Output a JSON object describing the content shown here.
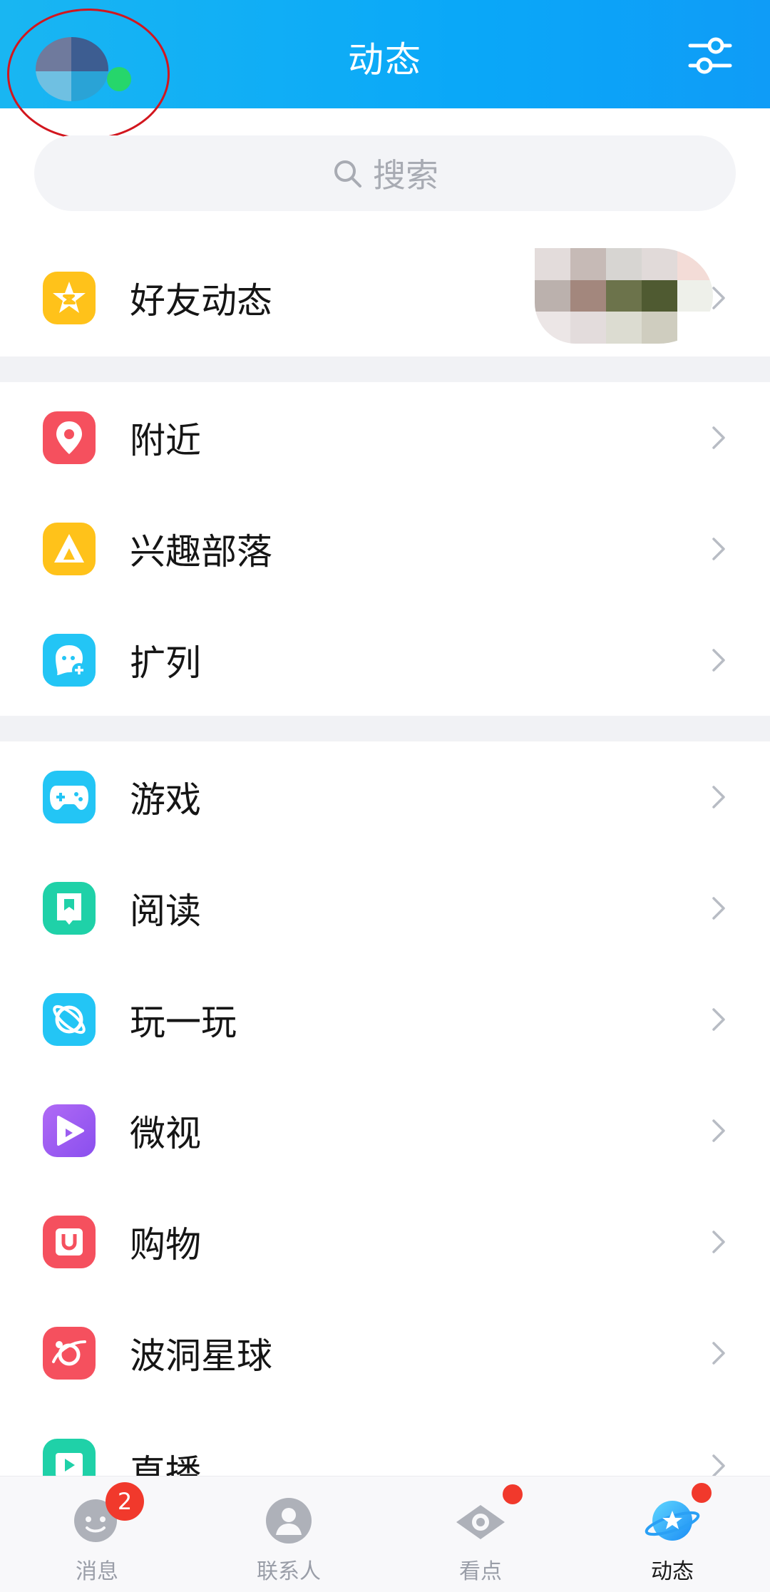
{
  "header": {
    "title": "动态"
  },
  "search": {
    "placeholder": "搜索"
  },
  "sections": [
    {
      "items": [
        {
          "label": "好友动态",
          "icon": "qzone-star-icon"
        }
      ]
    },
    {
      "items": [
        {
          "label": "附近",
          "icon": "location-pin-icon"
        },
        {
          "label": "兴趣部落",
          "icon": "tent-icon"
        },
        {
          "label": "扩列",
          "icon": "add-friend-face-icon"
        }
      ]
    },
    {
      "items": [
        {
          "label": "游戏",
          "icon": "gamepad-icon"
        },
        {
          "label": "阅读",
          "icon": "book-icon"
        },
        {
          "label": "玩一玩",
          "icon": "planet-icon"
        },
        {
          "label": "微视",
          "icon": "video-play-icon"
        },
        {
          "label": "购物",
          "icon": "shopping-bag-icon"
        },
        {
          "label": "波洞星球",
          "icon": "comic-planet-icon"
        },
        {
          "label": "直播",
          "icon": "live-icon"
        }
      ]
    }
  ],
  "tabs": [
    {
      "label": "消息",
      "icon": "message-face-icon",
      "badge": "2"
    },
    {
      "label": "联系人",
      "icon": "contacts-icon"
    },
    {
      "label": "看点",
      "icon": "eye-icon"
    },
    {
      "label": "动态",
      "icon": "star-planet-icon",
      "active": true
    }
  ],
  "colors": {
    "header": "#0aa8f8",
    "badge": "#f1392c",
    "qzone": "#ffc21a",
    "location": "#f5505e",
    "tent": "#ffc21a",
    "addfriend": "#23c5f5",
    "gamepad": "#23c5f5",
    "book": "#1fd1a8",
    "planet": "#23c5f5",
    "video": "#9b5cf0",
    "shop": "#f5505e",
    "comic": "#f5505e",
    "live": "#1fd1a8"
  }
}
